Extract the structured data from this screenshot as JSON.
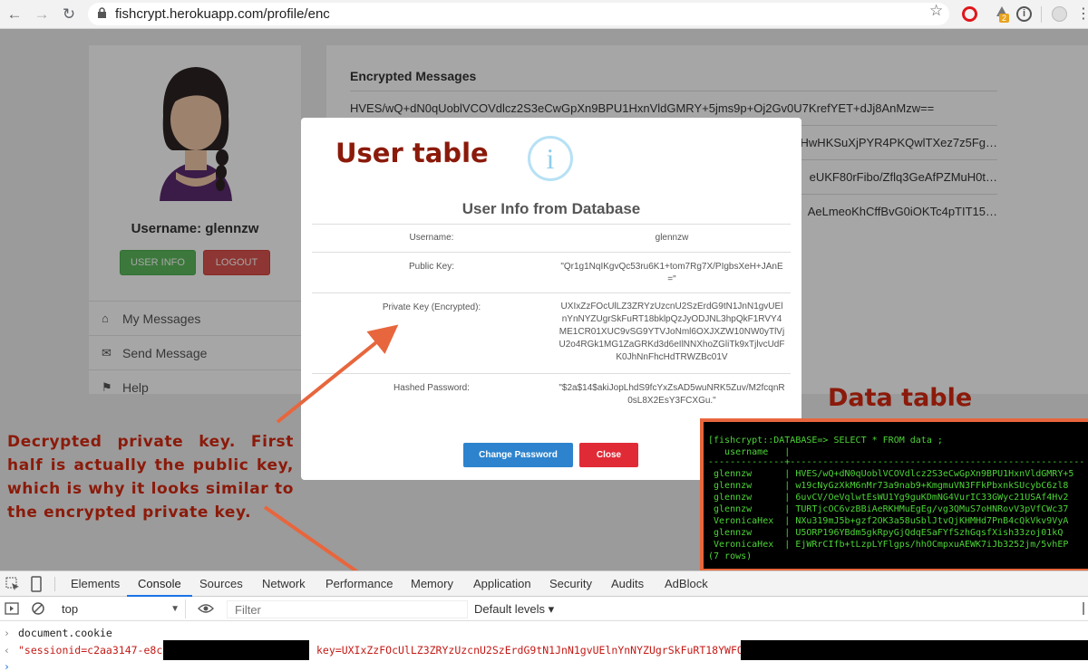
{
  "browser": {
    "url": "fishcrypt.herokuapp.com/profile/enc",
    "badge_count": "2",
    "info_glyph": "i"
  },
  "profile": {
    "username_line": "Username: glennzw",
    "user_info_button": "USER INFO",
    "logout_button": "LOGOUT",
    "sidebar": [
      {
        "label": "My Messages",
        "icon": "home-icon"
      },
      {
        "label": "Send Message",
        "icon": "envelope-icon"
      },
      {
        "label": "Help",
        "icon": "flag-icon"
      }
    ]
  },
  "messages": {
    "title": "Encrypted Messages",
    "rows": [
      "HVES/wQ+dN0qUoblVCOVdlcz2S3eCwGpXn9BPU1HxnVldGMRY+5jms9p+Oj2Gv0U7KrefYET+dJj8AnMzw==",
      "HwHKSuXjPYR4PKQwlTXez7z5Fg…",
      "eUKF80rFibo/Zflq3GeAfPZMuH0t…",
      "AeLmeoKhCffBvG0iOKTc4pTIT15…"
    ]
  },
  "modal": {
    "icon_glyph": "i",
    "title": "User Info from Database",
    "rows": [
      {
        "label": "Username:",
        "value": "glennzw"
      },
      {
        "label": "Public Key:",
        "value": "\"Qr1g1NqIKgvQc53ru6K1+tom7Rg7X/PIgbsXeH+JAnE=\""
      },
      {
        "label": "Private Key (Encrypted):",
        "value": "UXIxZzFOcUlLZ3ZRYzUzcnU2SzErdG9tN1JnN1gvUElnYnNYZUgrSkFuRT18bklpQzJyODJNL3hpQkF1RVY4ME1CR01XUC9vSG9YTVJoNml6OXJXZW10NW0yTlVjU2o4RGk1MG1ZaGRKd3d6eIlNNXhoZGliTk9xTjlvcUdFK0JhNnFhcHdTRWZBc01V"
      },
      {
        "label": "Hashed Password:",
        "value": "\"$2a$14$akiJopLhdS9fcYxZsAD5wuNRK5Zuv/M2fcqnR0sL8X2EsY3FCXGu.\""
      }
    ],
    "change_password_button": "Change Password",
    "close_button": "Close"
  },
  "annotations": {
    "user_table": "User table",
    "data_table": "Data table",
    "decrypted_note": "Decrypted private key. First half is actually the public key, which is why it looks similar to the encrypted private key."
  },
  "terminal": {
    "lines": [
      "[fishcrypt::DATABASE=> SELECT * FROM data ;",
      "   username   |",
      "--------------+------------------------------------------------------",
      " glennzw      | HVES/wQ+dN0qUoblVCOVdlcz2S3eCwGpXn9BPU1HxnVldGMRY+5",
      " glennzw      | w19cNyGzXkM6nMr73a9nab9+KmgmuVN3FFkPbxnkSUcybC6zl8",
      " glennzw      | 6uvCV/OeVqlwtEsWU1Yg9guKDmNG4VurIC33GWyc21USAf4Hv2",
      " glennzw      | TURTjcOC6vzBBiAeRKHMuEgEg/vg3QMuS7oHNRovV3pVfCWc37",
      " VeronicaHex  | NXu319mJ5b+gzf2OK3a58uSblJtvQjKHMHd7PnB4cQkVkv9VyA",
      " glennzw      | U5ORP196YBdm5gkRpyGjQdqESaFYfSzhGqsfXish33zoj01kQ",
      " VeronicaHex  | EjWRrCIfb+tLzpLYFlgps/hhOCmpxuAEWK7iJb3252jm/5vhEP",
      "(7 rows)"
    ]
  },
  "devtools": {
    "tabs": [
      "Elements",
      "Console",
      "Sources",
      "Network",
      "Performance",
      "Memory",
      "Application",
      "Security",
      "Audits",
      "AdBlock"
    ],
    "active_tab": "Console",
    "context": "top",
    "filter_placeholder": "Filter",
    "levels": "Default levels ▾",
    "console": {
      "input": "document.cookie",
      "output_start": "\"sessionid=c2aa3147-e8c8",
      "output_key": "key=UXIxZzFOcUlLZ3ZRYzUzcnU2SzErdG9tN1JnN1gvUElnYnNYZUgrSkFuRT18YWFOWS"
    }
  },
  "colors": {
    "annotation": "#8b1a0a",
    "terminal_text": "#4cd437",
    "terminal_border": "#e8663d",
    "arrow": "#e8663d",
    "success": "#5cb85c",
    "danger": "#d9534f",
    "primary": "#2d83cd"
  }
}
